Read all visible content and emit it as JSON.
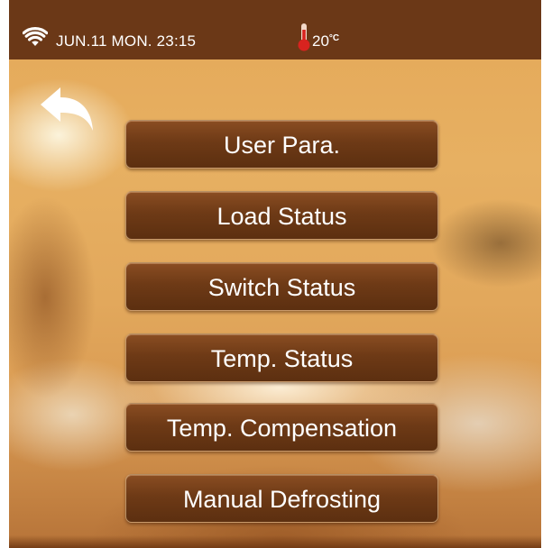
{
  "status_bar": {
    "date_time": "JUN.11 MON. 23:15",
    "temperature": "20",
    "temperature_unit": "°C"
  },
  "icons": {
    "wifi": "wifi-icon",
    "thermometer": "thermometer-icon",
    "back": "back-arrow-icon"
  },
  "menu": {
    "items": [
      {
        "label": "User Para."
      },
      {
        "label": "Load Status"
      },
      {
        "label": "Switch Status"
      },
      {
        "label": "Temp. Status"
      },
      {
        "label": "Temp. Compensation"
      },
      {
        "label": "Manual Defrosting"
      }
    ]
  },
  "colors": {
    "status_bar_bg": "#6b3817",
    "button_bg": "#6e3a16",
    "thermometer_red": "#d8231f",
    "text": "#ffffff"
  }
}
